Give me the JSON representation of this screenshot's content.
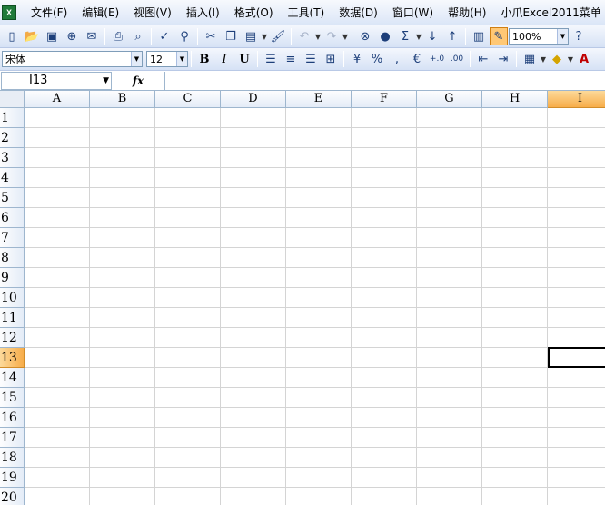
{
  "menubar": {
    "items": [
      {
        "id": "file",
        "label": "文件(F)"
      },
      {
        "id": "edit",
        "label": "编辑(E)"
      },
      {
        "id": "view",
        "label": "视图(V)"
      },
      {
        "id": "insert",
        "label": "插入(I)"
      },
      {
        "id": "format",
        "label": "格式(O)"
      },
      {
        "id": "tools",
        "label": "工具(T)"
      },
      {
        "id": "data",
        "label": "数据(D)"
      },
      {
        "id": "window",
        "label": "窗口(W)"
      },
      {
        "id": "help",
        "label": "帮助(H)"
      },
      {
        "id": "addin",
        "label": "小爪Excel2011菜单"
      }
    ]
  },
  "toolbar_standard": {
    "zoom_value": "100%"
  },
  "toolbar_format": {
    "font_name": "宋体",
    "font_size": "12",
    "bold_label": "B",
    "italic_label": "I",
    "underline_label": "U",
    "percent_label": "%",
    "comma_label": ",",
    "euro_label": "€",
    "increase_decimal_label": "+.0",
    "decrease_decimal_label": ".00"
  },
  "formula_bar": {
    "name_box": "I13",
    "fx_label": "fx",
    "formula": ""
  },
  "sheet": {
    "columns": [
      "A",
      "B",
      "C",
      "D",
      "E",
      "F",
      "G",
      "H",
      "I"
    ],
    "rows": [
      "1",
      "2",
      "3",
      "4",
      "5",
      "6",
      "7",
      "8",
      "9",
      "10",
      "11",
      "12",
      "13",
      "14",
      "15",
      "16",
      "17",
      "18",
      "19",
      "20"
    ],
    "selected_column": "I",
    "selected_row": "13"
  },
  "colors": {
    "header_selected": "#f7ad4a",
    "gridline": "#d4d4d4",
    "toolbar_bg": "#dbe6f7"
  }
}
